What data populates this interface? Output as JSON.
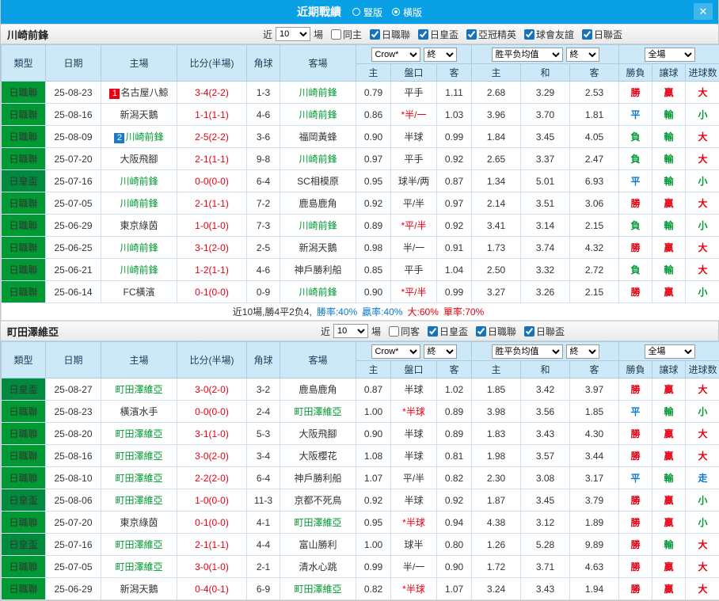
{
  "titlebar": {
    "title": "近期戰績",
    "radios": [
      {
        "label": "豎版",
        "selected": false
      },
      {
        "label": "橫版",
        "selected": true
      }
    ],
    "close_icon": "✕"
  },
  "filter_labels": {
    "near": "近",
    "games": "場"
  },
  "table_header": {
    "type": "類型",
    "date": "日期",
    "home": "主場",
    "score": "比分(半場)",
    "corner": "角球",
    "away": "客場",
    "odds1_select": "Crow*",
    "odds1_final": "終",
    "odds1_cols": [
      "主",
      "盤口",
      "客"
    ],
    "odds2_select": "胜平负均值",
    "odds2_final": "終",
    "odds2_cols": [
      "主",
      "和",
      "客"
    ],
    "result_select": "全場",
    "result_cols": [
      "勝負",
      "讓球",
      "进球数"
    ]
  },
  "colors": {
    "titlebar_bg": "#0aa0e5",
    "subject_team": "#009933",
    "opponent_team": "#333333",
    "score": "#e60012",
    "handicap_marked": "#e60012",
    "handicap_plain": "#333333",
    "type_badge": {
      "日職聯": "#009933",
      "日皇盃": "#008a3e"
    },
    "result": {
      "勝": "#e60012",
      "平": "#0b79d0",
      "負": "#009933",
      "贏": "#e60012",
      "輸": "#009933",
      "走": "#0b79d0",
      "大": "#e60012",
      "小": "#009933"
    }
  },
  "sections": [
    {
      "team": "川崎前鋒",
      "filter": {
        "count": "10",
        "checkboxes": [
          {
            "label": "同主",
            "checked": false
          },
          {
            "label": "日職聯",
            "checked": true
          },
          {
            "label": "日皇盃",
            "checked": true
          },
          {
            "label": "亞冠精英",
            "checked": true
          },
          {
            "label": "球會友誼",
            "checked": true
          },
          {
            "label": "日聯盃",
            "checked": true
          }
        ]
      },
      "rows": [
        {
          "type": "日職聯",
          "date": "25-08-23",
          "home": "名古屋八鯨",
          "home_badge": {
            "text": "1",
            "color": "#e60012"
          },
          "home_subject": false,
          "score": "3-4(2-2)",
          "corner": "1-3",
          "away": "川崎前鋒",
          "away_subject": true,
          "odds_home": "0.79",
          "handicap": "平手",
          "handicap_red": false,
          "odds_away": "1.11",
          "avg_home": "2.68",
          "avg_draw": "3.29",
          "avg_away": "2.53",
          "res_wdl": "勝",
          "res_handicap": "贏",
          "res_goals": "大"
        },
        {
          "type": "日職聯",
          "date": "25-08-16",
          "home": "新潟天鵝",
          "home_subject": false,
          "score": "1-1(1-1)",
          "corner": "4-6",
          "away": "川崎前鋒",
          "away_subject": true,
          "odds_home": "0.86",
          "handicap": "*半/一",
          "handicap_red": true,
          "odds_away": "1.03",
          "avg_home": "3.96",
          "avg_draw": "3.70",
          "avg_away": "1.81",
          "res_wdl": "平",
          "res_handicap": "輸",
          "res_goals": "小"
        },
        {
          "type": "日職聯",
          "date": "25-08-09",
          "home": "川崎前鋒",
          "home_badge": {
            "text": "2",
            "color": "#1e7ac4"
          },
          "home_subject": true,
          "score": "2-5(2-2)",
          "corner": "3-6",
          "away": "福岡黃蜂",
          "away_subject": false,
          "odds_home": "0.90",
          "handicap": "半球",
          "handicap_red": false,
          "odds_away": "0.99",
          "avg_home": "1.84",
          "avg_draw": "3.45",
          "avg_away": "4.05",
          "res_wdl": "負",
          "res_handicap": "輸",
          "res_goals": "大"
        },
        {
          "type": "日職聯",
          "date": "25-07-20",
          "home": "大阪飛腳",
          "home_subject": false,
          "score": "2-1(1-1)",
          "corner": "9-8",
          "away": "川崎前鋒",
          "away_subject": true,
          "odds_home": "0.97",
          "handicap": "平手",
          "handicap_red": false,
          "odds_away": "0.92",
          "avg_home": "2.65",
          "avg_draw": "3.37",
          "avg_away": "2.47",
          "res_wdl": "負",
          "res_handicap": "輸",
          "res_goals": "大"
        },
        {
          "type": "日皇盃",
          "date": "25-07-16",
          "home": "川崎前鋒",
          "home_subject": true,
          "score": "0-0(0-0)",
          "corner": "6-4",
          "away": "SC相模原",
          "away_subject": false,
          "odds_home": "0.95",
          "handicap": "球半/两",
          "handicap_red": false,
          "odds_away": "0.87",
          "avg_home": "1.34",
          "avg_draw": "5.01",
          "avg_away": "6.93",
          "res_wdl": "平",
          "res_handicap": "輸",
          "res_goals": "小"
        },
        {
          "type": "日職聯",
          "date": "25-07-05",
          "home": "川崎前鋒",
          "home_subject": true,
          "score": "2-1(1-1)",
          "corner": "7-2",
          "away": "鹿島鹿角",
          "away_subject": false,
          "odds_home": "0.92",
          "handicap": "平/半",
          "handicap_red": false,
          "odds_away": "0.97",
          "avg_home": "2.14",
          "avg_draw": "3.51",
          "avg_away": "3.06",
          "res_wdl": "勝",
          "res_handicap": "贏",
          "res_goals": "大"
        },
        {
          "type": "日職聯",
          "date": "25-06-29",
          "home": "東京綠茵",
          "home_subject": false,
          "score": "1-0(1-0)",
          "corner": "7-3",
          "away": "川崎前鋒",
          "away_subject": true,
          "odds_home": "0.89",
          "handicap": "*平/半",
          "handicap_red": true,
          "odds_away": "0.92",
          "avg_home": "3.41",
          "avg_draw": "3.14",
          "avg_away": "2.15",
          "res_wdl": "負",
          "res_handicap": "輸",
          "res_goals": "小"
        },
        {
          "type": "日職聯",
          "date": "25-06-25",
          "home": "川崎前鋒",
          "home_subject": true,
          "score": "3-1(2-0)",
          "corner": "2-5",
          "away": "新潟天鵝",
          "away_subject": false,
          "odds_home": "0.98",
          "handicap": "半/一",
          "handicap_red": false,
          "odds_away": "0.91",
          "avg_home": "1.73",
          "avg_draw": "3.74",
          "avg_away": "4.32",
          "res_wdl": "勝",
          "res_handicap": "贏",
          "res_goals": "大"
        },
        {
          "type": "日職聯",
          "date": "25-06-21",
          "home": "川崎前鋒",
          "home_subject": true,
          "score": "1-2(1-1)",
          "corner": "4-6",
          "away": "神戶勝利船",
          "away_subject": false,
          "odds_home": "0.85",
          "handicap": "平手",
          "handicap_red": false,
          "odds_away": "1.04",
          "avg_home": "2.50",
          "avg_draw": "3.32",
          "avg_away": "2.72",
          "res_wdl": "負",
          "res_handicap": "輸",
          "res_goals": "大"
        },
        {
          "type": "日職聯",
          "date": "25-06-14",
          "home": "FC橫濱",
          "home_subject": false,
          "score": "0-1(0-0)",
          "corner": "0-9",
          "away": "川崎前鋒",
          "away_subject": true,
          "odds_home": "0.90",
          "handicap": "*平/半",
          "handicap_red": true,
          "odds_away": "0.99",
          "avg_home": "3.27",
          "avg_draw": "3.26",
          "avg_away": "2.15",
          "res_wdl": "勝",
          "res_handicap": "贏",
          "res_goals": "小"
        }
      ],
      "summary": [
        {
          "text": "近10場,勝4平2负4,",
          "color": "#333333"
        },
        {
          "text": "勝率:40%",
          "color": "#0b79d0"
        },
        {
          "text": "贏率:40%",
          "color": "#0b79d0"
        },
        {
          "text": "大:60%",
          "color": "#e60012"
        },
        {
          "text": "單率:70%",
          "color": "#e60012"
        }
      ]
    },
    {
      "team": "町田澤維亞",
      "filter": {
        "count": "10",
        "checkboxes": [
          {
            "label": "同客",
            "checked": false
          },
          {
            "label": "日皇盃",
            "checked": true
          },
          {
            "label": "日職聯",
            "checked": true
          },
          {
            "label": "日聯盃",
            "checked": true
          }
        ]
      },
      "rows": [
        {
          "type": "日皇盃",
          "date": "25-08-27",
          "home": "町田澤維亞",
          "home_subject": true,
          "score": "3-0(2-0)",
          "corner": "3-2",
          "away": "鹿島鹿角",
          "away_subject": false,
          "odds_home": "0.87",
          "handicap": "半球",
          "handicap_red": false,
          "odds_away": "1.02",
          "avg_home": "1.85",
          "avg_draw": "3.42",
          "avg_away": "3.97",
          "res_wdl": "勝",
          "res_handicap": "贏",
          "res_goals": "大"
        },
        {
          "type": "日職聯",
          "date": "25-08-23",
          "home": "橫濱水手",
          "home_subject": false,
          "score": "0-0(0-0)",
          "corner": "2-4",
          "away": "町田澤維亞",
          "away_subject": true,
          "odds_home": "1.00",
          "handicap": "*半球",
          "handicap_red": true,
          "odds_away": "0.89",
          "avg_home": "3.98",
          "avg_draw": "3.56",
          "avg_away": "1.85",
          "res_wdl": "平",
          "res_handicap": "輸",
          "res_goals": "小"
        },
        {
          "type": "日職聯",
          "date": "25-08-20",
          "home": "町田澤維亞",
          "home_subject": true,
          "score": "3-1(1-0)",
          "corner": "5-3",
          "away": "大阪飛腳",
          "away_subject": false,
          "odds_home": "0.90",
          "handicap": "半球",
          "handicap_red": false,
          "odds_away": "0.89",
          "avg_home": "1.83",
          "avg_draw": "3.43",
          "avg_away": "4.30",
          "res_wdl": "勝",
          "res_handicap": "贏",
          "res_goals": "大"
        },
        {
          "type": "日職聯",
          "date": "25-08-16",
          "home": "町田澤維亞",
          "home_subject": true,
          "score": "3-0(2-0)",
          "corner": "3-4",
          "away": "大阪櫻花",
          "away_subject": false,
          "odds_home": "1.08",
          "handicap": "半球",
          "handicap_red": false,
          "odds_away": "0.81",
          "avg_home": "1.98",
          "avg_draw": "3.57",
          "avg_away": "3.44",
          "res_wdl": "勝",
          "res_handicap": "贏",
          "res_goals": "大"
        },
        {
          "type": "日職聯",
          "date": "25-08-10",
          "home": "町田澤維亞",
          "home_subject": true,
          "score": "2-2(2-0)",
          "corner": "6-4",
          "away": "神戶勝利船",
          "away_subject": false,
          "odds_home": "1.07",
          "handicap": "平/半",
          "handicap_red": false,
          "odds_away": "0.82",
          "avg_home": "2.30",
          "avg_draw": "3.08",
          "avg_away": "3.17",
          "res_wdl": "平",
          "res_handicap": "輸",
          "res_goals": "走"
        },
        {
          "type": "日皇盃",
          "date": "25-08-06",
          "home": "町田澤維亞",
          "home_subject": true,
          "score": "1-0(0-0)",
          "corner": "11-3",
          "away": "京都不死鳥",
          "away_subject": false,
          "odds_home": "0.92",
          "handicap": "半球",
          "handicap_red": false,
          "odds_away": "0.92",
          "avg_home": "1.87",
          "avg_draw": "3.45",
          "avg_away": "3.79",
          "res_wdl": "勝",
          "res_handicap": "贏",
          "res_goals": "小"
        },
        {
          "type": "日職聯",
          "date": "25-07-20",
          "home": "東京綠茵",
          "home_subject": false,
          "score": "0-1(0-0)",
          "corner": "4-1",
          "away": "町田澤維亞",
          "away_subject": true,
          "odds_home": "0.95",
          "handicap": "*半球",
          "handicap_red": true,
          "odds_away": "0.94",
          "avg_home": "4.38",
          "avg_draw": "3.12",
          "avg_away": "1.89",
          "res_wdl": "勝",
          "res_handicap": "贏",
          "res_goals": "小"
        },
        {
          "type": "日皇盃",
          "date": "25-07-16",
          "home": "町田澤維亞",
          "home_subject": true,
          "score": "2-1(1-1)",
          "corner": "4-4",
          "away": "富山勝利",
          "away_subject": false,
          "odds_home": "1.00",
          "handicap": "球半",
          "handicap_red": false,
          "odds_away": "0.80",
          "avg_home": "1.26",
          "avg_draw": "5.28",
          "avg_away": "9.89",
          "res_wdl": "勝",
          "res_handicap": "輸",
          "res_goals": "大"
        },
        {
          "type": "日職聯",
          "date": "25-07-05",
          "home": "町田澤維亞",
          "home_subject": true,
          "score": "3-0(1-0)",
          "corner": "2-1",
          "away": "清水心跳",
          "away_subject": false,
          "odds_home": "0.99",
          "handicap": "半/一",
          "handicap_red": false,
          "odds_away": "0.90",
          "avg_home": "1.72",
          "avg_draw": "3.71",
          "avg_away": "4.63",
          "res_wdl": "勝",
          "res_handicap": "贏",
          "res_goals": "大"
        },
        {
          "type": "日職聯",
          "date": "25-06-29",
          "home": "新潟天鵝",
          "home_subject": false,
          "score": "0-4(0-1)",
          "corner": "6-9",
          "away": "町田澤維亞",
          "away_subject": true,
          "odds_home": "0.82",
          "handicap": "*半球",
          "handicap_red": true,
          "odds_away": "1.07",
          "avg_home": "3.24",
          "avg_draw": "3.43",
          "avg_away": "1.94",
          "res_wdl": "勝",
          "res_handicap": "贏",
          "res_goals": "大"
        }
      ],
      "summary": null
    }
  ]
}
